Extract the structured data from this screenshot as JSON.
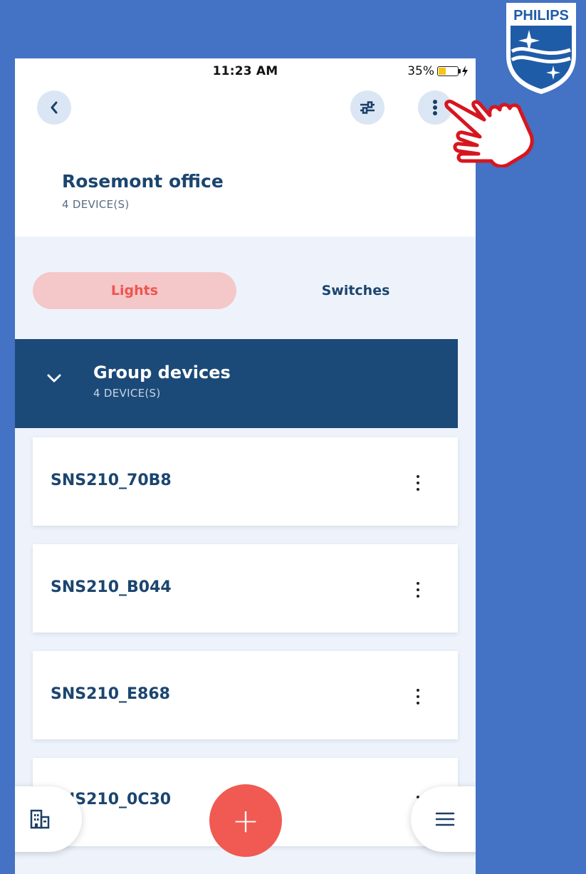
{
  "brand": {
    "logo_text": "PHILIPS"
  },
  "status_bar": {
    "time": "11:23 AM",
    "battery": "35%"
  },
  "header": {
    "back_icon": "chevron-left-icon",
    "filter_icon": "sliders-icon",
    "more_icon": "vertical-dots-icon",
    "title": "Rosemont office",
    "subtitle": "4 DEVICE(S)"
  },
  "tabs": [
    {
      "label": "Lights",
      "active": true
    },
    {
      "label": "Switches",
      "active": false
    }
  ],
  "group": {
    "title": "Group devices",
    "subtitle": "4 DEVICE(S)",
    "expanded": true
  },
  "devices": [
    {
      "name": "SNS210_70B8"
    },
    {
      "name": "SNS210_B044"
    },
    {
      "name": "SNS210_E868"
    },
    {
      "name": "SNS210_0C30"
    }
  ],
  "bottom_nav": {
    "left_icon": "building-icon",
    "add_label": "+",
    "right_icon": "menu-icon"
  },
  "colors": {
    "background": "#4472c4",
    "primary": "#1b456f",
    "accent": "#f05a52",
    "active_tab_bg": "#f4c7c9",
    "group_bar": "#1b4a78"
  }
}
